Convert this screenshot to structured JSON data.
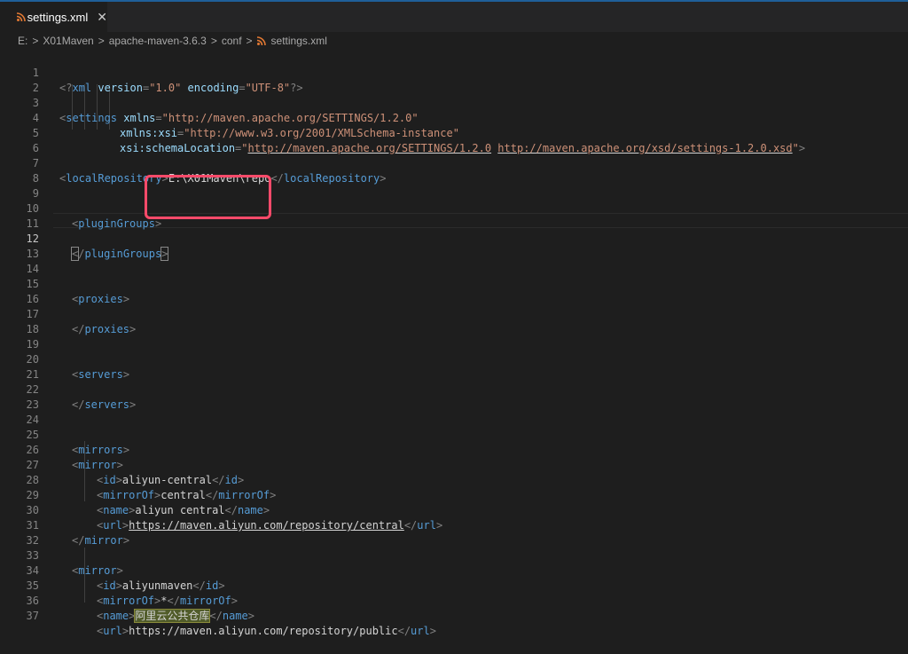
{
  "tab": {
    "label": "settings.xml",
    "close": "✕",
    "icon": "rss-icon"
  },
  "breadcrumb": [
    "E:",
    "X01Maven",
    "apache-maven-3.6.3",
    "conf",
    "settings.xml"
  ],
  "breadcrumb_sep": ">",
  "lines": {
    "n1": "1",
    "n2": "2",
    "n3": "3",
    "n4": "4",
    "n5": "5",
    "n6": "6",
    "n7": "7",
    "n8": "8",
    "n9": "9",
    "n10": "10",
    "n11": "11",
    "n12": "12",
    "n13": "13",
    "n14": "14",
    "n15": "15",
    "n16": "16",
    "n17": "17",
    "n18": "18",
    "n19": "19",
    "n20": "20",
    "n21": "21",
    "n22": "22",
    "n23": "23",
    "n24": "24",
    "n25": "25",
    "n26": "26",
    "n27": "27",
    "n28": "28",
    "n29": "29",
    "n30": "30",
    "n31": "31",
    "n32": "32",
    "n33": "33",
    "n34": "34",
    "n35": "35",
    "n36": "36",
    "n37": "37"
  },
  "code": {
    "xmldecl_open": "<?",
    "xmldecl_name": "xml",
    "xmldecl_version_attr": "version",
    "xmldecl_version_val": "\"1.0\"",
    "xmldecl_encoding_attr": "encoding",
    "xmldecl_encoding_val": "\"UTF-8\"",
    "xmldecl_close": "?>",
    "settings_tag": "settings",
    "xmlns_attr": "xmlns",
    "xmlns_val": "\"http://maven.apache.org/SETTINGS/1.2.0\"",
    "xsi_attr": "xmlns:xsi",
    "xsi_val": "\"http://www.w3.org/2001/XMLSchema-instance\"",
    "schema_attr": "xsi:schemaLocation",
    "schema_val_q1": "\"",
    "schema_val_u1": "http://maven.apache.org/SETTINGS/1.2.0",
    "schema_val_sp": " ",
    "schema_val_u2": "http://maven.apache.org/xsd/settings-1.2.0.xsd",
    "schema_val_q2": "\"",
    "localRepository_tag": "localRepository",
    "localRepository_val": "E:\\X01Maven\\repo",
    "pluginGroups_tag": "pluginGroups",
    "proxies_tag": "proxies",
    "servers_tag": "servers",
    "mirrors_tag": "mirrors",
    "mirror_tag": "mirror",
    "id_tag": "id",
    "mirrorOf_tag": "mirrorOf",
    "name_tag": "name",
    "url_tag": "url",
    "m1_id": "aliyun-central",
    "m1_mirrorOf": "central",
    "m1_name": "aliyun central",
    "m1_url": "https://maven.aliyun.com/repository/central",
    "m2_id": "aliyunmaven",
    "m2_mirrorOf": "*",
    "m2_name": "阿里云公共仓库",
    "m2_url": "https://maven.aliyun.com/repository/public"
  },
  "colors": {
    "tag": "#569cd6",
    "attr": "#9cdcfe",
    "value": "#ce9178",
    "punct": "#808080",
    "highlight_box": "#ff4a6a"
  }
}
